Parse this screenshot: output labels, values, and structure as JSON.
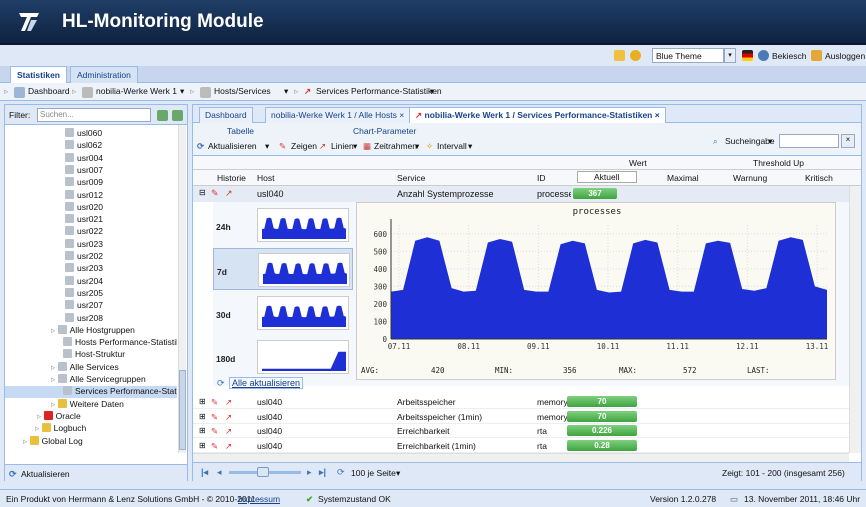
{
  "app": {
    "title": "HL-Monitoring Module"
  },
  "topbar": {
    "theme": "Blue Theme",
    "user": "Bekiesch",
    "logout": "Ausloggen"
  },
  "main_tabs": [
    {
      "label": "Statistiken"
    },
    {
      "label": "Administration"
    }
  ],
  "breadcrumb": {
    "items": [
      "Dashboard",
      "nobilia-Werke Werk 1",
      "Hosts/Services",
      "Services Performance-Statistiken"
    ]
  },
  "left": {
    "filter_label": "Filter:",
    "filter_placeholder": "Suchen...",
    "tree": [
      "usl060",
      "usl062",
      "usr004",
      "usr007",
      "usr009",
      "usr012",
      "usr020",
      "usr021",
      "usr022",
      "usr023",
      "usr202",
      "usr203",
      "usr204",
      "usr205",
      "usr207",
      "usr208",
      "Alle Hostgruppen",
      "Hosts Performance-Statistiken",
      "Host-Struktur",
      "Alle Services",
      "Alle Servicegruppen",
      "Services Performance-Statistik",
      "Weitere Daten",
      "Oracle",
      "Logbuch",
      "Global Log"
    ],
    "refresh": "Aktualisieren"
  },
  "sub_tabs": [
    {
      "label": "Dashboard"
    },
    {
      "label": "nobilia-Werke Werk 1 / Alle Hosts"
    },
    {
      "label": "nobilia-Werke Werk 1 / Services Performance-Statistiken"
    }
  ],
  "toolbar": {
    "group_table": "Tabelle",
    "group_chart": "Chart-Parameter",
    "refresh": "Aktualisieren",
    "show": "Zeigen",
    "lines": "Linien",
    "timeframe": "Zeitrahmen",
    "interval": "Intervall",
    "search_label": "Sucheingabe"
  },
  "grid": {
    "group_value": "Wert",
    "group_threshold": "Threshold Up",
    "columns": [
      "Historie",
      "Host",
      "Service",
      "ID",
      "Aktuell",
      "Maximal",
      "Warnung",
      "Kritisch"
    ],
    "expanded_row": {
      "host": "usl040",
      "service": "Anzahl Systemprozesse",
      "id": "processes",
      "current": "367"
    },
    "periods": [
      "24h",
      "7d",
      "30d",
      "180d"
    ],
    "refresh_all": "Alle aktualisieren",
    "rows": [
      {
        "host": "usl040",
        "service": "Arbeitsspeicher",
        "id": "memory",
        "current": "70"
      },
      {
        "host": "usl040",
        "service": "Arbeitsspeicher (1min)",
        "id": "memory",
        "current": "70"
      },
      {
        "host": "usl040",
        "service": "Erreichbarkeit",
        "id": "rta",
        "current": "0.226"
      },
      {
        "host": "usl040",
        "service": "Erreichbarkeit (1min)",
        "id": "rta",
        "current": "0.28"
      }
    ]
  },
  "chart_data": {
    "type": "area",
    "title": "processes",
    "x_ticks": [
      "07.11",
      "08.11",
      "09.11",
      "10.11",
      "11.11",
      "12.11",
      "13.11"
    ],
    "y_ticks": [
      0,
      100,
      200,
      300,
      400,
      500,
      600
    ],
    "ylim": [
      0,
      650
    ],
    "series": [
      {
        "values": [
          270,
          280,
          560,
          580,
          560,
          290,
          270,
          275,
          550,
          570,
          555,
          280,
          270,
          270,
          540,
          560,
          545,
          280,
          265,
          270,
          545,
          565,
          550,
          280,
          270,
          270,
          545,
          560,
          548,
          285,
          275,
          290,
          560,
          580,
          565,
          300,
          280
        ]
      }
    ],
    "color": "#1f2fd6",
    "footer": {
      "avg_label": "AVG:",
      "avg": "420",
      "min_label": "MIN:",
      "min": "356",
      "max_label": "MAX:",
      "max": "572",
      "last_label": "LAST:",
      "last": ""
    }
  },
  "pager": {
    "per_page": "100 je Seite",
    "summary": "Zeigt: 101 - 200 (insgesamt 256)"
  },
  "status": {
    "credit": "Ein Produkt von Herrmann & Lenz Solutions GmbH - © 2010-2011 -",
    "impressum": "Impressum",
    "system": "Systemzustand OK",
    "version": "Version 1.2.0.278",
    "datetime": "13. November 2011, 18:46 Uhr"
  }
}
